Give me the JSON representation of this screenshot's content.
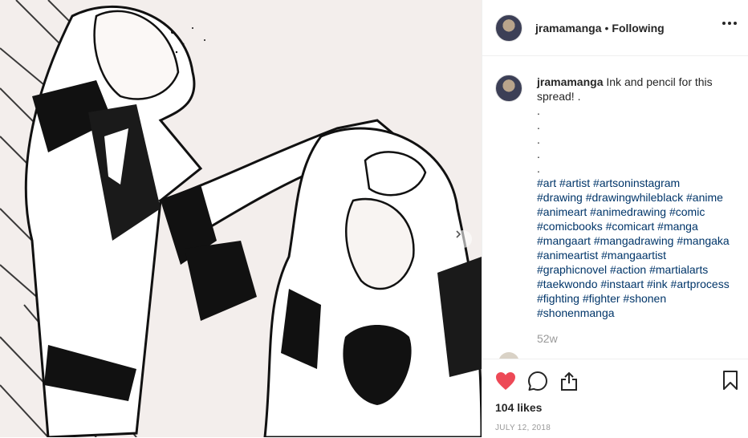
{
  "post": {
    "username": "jramamanga",
    "separator": "•",
    "follow_status": "Following",
    "caption": {
      "username": "jramamanga",
      "text": "Ink and pencil for this spread! .",
      "dots": [
        ".",
        ".",
        ".",
        ".",
        "."
      ],
      "hashtags": [
        "#art #artist #artsoninstagram",
        "#drawing #drawingwhileblack #anime",
        "#animeart #animedrawing #comic",
        "#comicbooks #comicart #manga",
        "#mangaart #mangadrawing #mangaka",
        "#animeartist #mangaartist",
        "#graphicnovel #action #martialarts",
        "#taekwondo #instaart #ink #artprocess",
        "#fighting #fighter #shonen",
        "#shonenmanga"
      ],
      "age": "52w"
    },
    "likes": "104 likes",
    "date": "July 12, 2018"
  },
  "icons": {
    "more": "more-options-icon",
    "like": "heart-icon",
    "comment": "comment-icon",
    "share": "share-icon",
    "save": "bookmark-icon",
    "next": "chevron-right-icon"
  },
  "colors": {
    "like_red": "#ed4956",
    "hashtag_blue": "#003569",
    "muted_gray": "#999999"
  }
}
